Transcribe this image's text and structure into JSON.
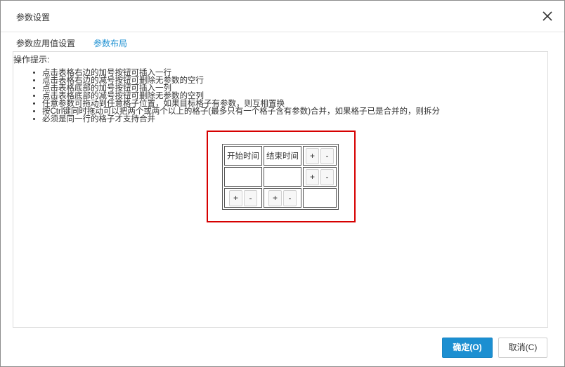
{
  "dialog": {
    "title": "参数设置",
    "close_icon": "close-icon"
  },
  "tabs": [
    {
      "label": "参数应用值设置",
      "active": false
    },
    {
      "label": "参数布局",
      "active": true
    }
  ],
  "hints": {
    "title": "操作提示:",
    "items": [
      "点击表格右边的加号按钮可插入一行",
      "点击表格右边的减号按钮可删除无参数的空行",
      "点击表格底部的加号按钮可插入一列",
      "点击表格底部的减号按钮可删除无参数的空列",
      "任意参数可拖动到任意格子位置，如果目标格子有参数，则互相置换",
      "按Ctrl键同时拖动可以把两个或两个以上的格子(最多只有一个格子含有参数)合并，如果格子已是合并的，则拆分",
      "必须是同一行的格子才支持合并"
    ]
  },
  "layout_grid": {
    "row1": {
      "cell1": "开始时间",
      "cell2": "结束时间"
    },
    "plus": "+",
    "minus": "-"
  },
  "footer": {
    "ok_label": "确定(O)",
    "cancel_label": "取消(C)"
  },
  "colors": {
    "accent": "#1c8fd1",
    "highlight_box": "#d60000"
  }
}
